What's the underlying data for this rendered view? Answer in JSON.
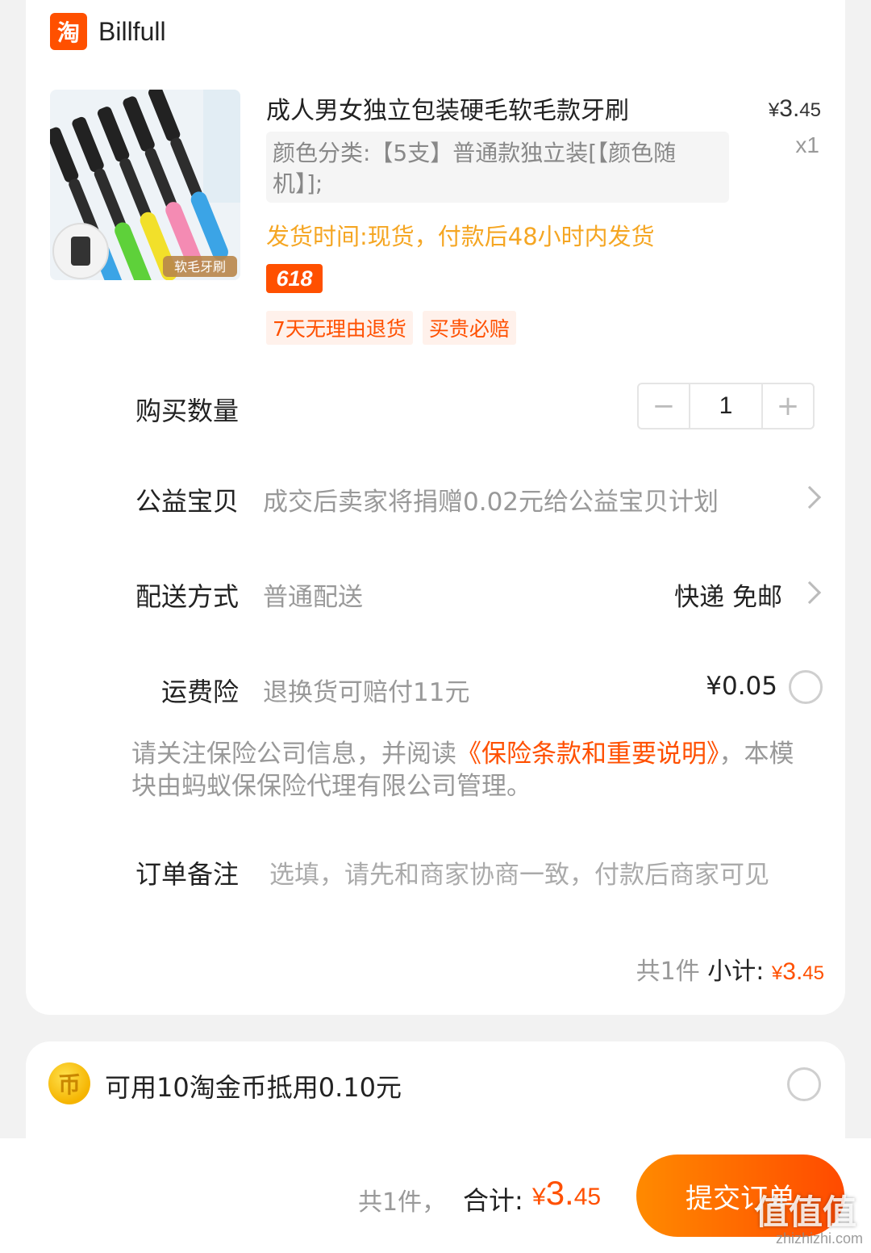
{
  "shop": {
    "logo_text": "淘",
    "name": "Billfull"
  },
  "product": {
    "image_label": "软毛牙刷",
    "title": "成人男女独立包装硬毛软毛款牙刷",
    "price_yen": "¥",
    "price_int": "3.",
    "price_dec": "45",
    "quantity": "x1",
    "sku": "颜色分类:【5支】普通款独立装[【颜色随机】];",
    "ship_time": "发货时间:现货，付款后48小时内发货",
    "promo_badge": "618",
    "tags": [
      "7天无理由退货",
      "买贵必赔"
    ]
  },
  "rows": {
    "qty_label": "购买数量",
    "qty_value": "1",
    "minus": "−",
    "plus": "+",
    "charity_label": "公益宝贝",
    "charity_value": "成交后卖家将捐赠0.02元给公益宝贝计划",
    "delivery_label": "配送方式",
    "delivery_value": "普通配送",
    "delivery_right": "快递 免邮",
    "insurance_label": "运费险",
    "insurance_value": "退换货可赔付11元",
    "insurance_price": "¥0.05",
    "insurance_note_pre": "请关注保险公司信息，并阅读",
    "insurance_note_link": "《保险条款和重要说明》",
    "insurance_note_post": "，本模块由蚂蚁保保险代理有限公司管理。",
    "remark_label": "订单备注",
    "remark_placeholder": "选填，请先和商家协商一致，付款后商家可见"
  },
  "subtotal": {
    "count": "共1件",
    "label": "小计:",
    "yen": "¥",
    "int": "3.",
    "dec": "45"
  },
  "coin": {
    "icon_text": "币",
    "text": "可用10淘金币抵用0.10元"
  },
  "bottom": {
    "count": "共1件，",
    "label": "合计:",
    "yen": "¥",
    "int": "3.",
    "dec": "45",
    "submit": "提交订单"
  },
  "watermark": {
    "text": "值值值",
    "url": "zhizhizhi.com"
  },
  "colors": {
    "accent": "#ff5000",
    "ship_time": "#f5a623",
    "muted": "#999999"
  }
}
